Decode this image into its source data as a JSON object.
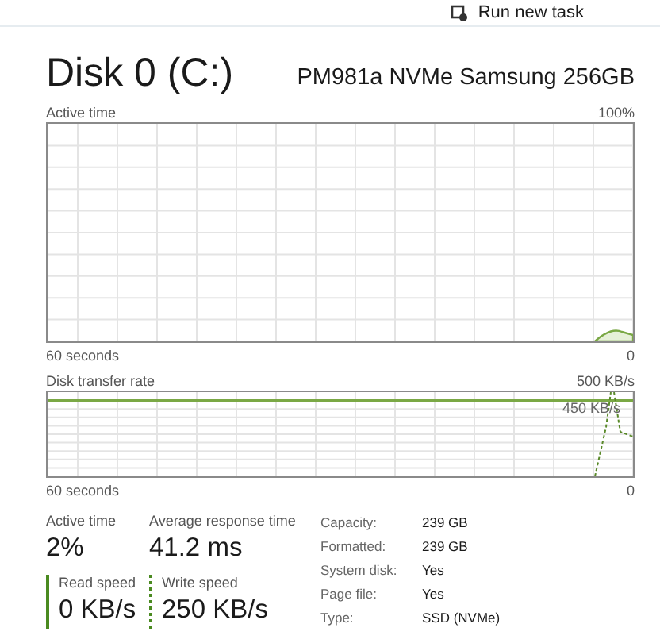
{
  "toolbar": {
    "run_task": "Run new task"
  },
  "header": {
    "title": "Disk 0 (C:)",
    "model": "PM981a NVMe Samsung 256GB"
  },
  "active_chart": {
    "label": "Active time",
    "max": "100%",
    "x_start": "60 seconds",
    "x_end": "0"
  },
  "transfer_chart": {
    "label": "Disk transfer rate",
    "max": "500 KB/s",
    "marker": "450 KB/s",
    "x_start": "60 seconds",
    "x_end": "0"
  },
  "stats": [
    {
      "label": "Active time",
      "value": "2%",
      "kind": "plain"
    },
    {
      "label": "Average response time",
      "value": "41.2 ms",
      "kind": "plain"
    },
    {
      "label": "Read speed",
      "value": "0 KB/s",
      "kind": "solid"
    },
    {
      "label": "Write speed",
      "value": "250 KB/s",
      "kind": "dotted"
    }
  ],
  "properties": [
    {
      "label": "Capacity:",
      "value": "239 GB"
    },
    {
      "label": "Formatted:",
      "value": "239 GB"
    },
    {
      "label": "System disk:",
      "value": "Yes"
    },
    {
      "label": "Page file:",
      "value": "Yes"
    },
    {
      "label": "Type:",
      "value": "SSD (NVMe)"
    }
  ]
}
